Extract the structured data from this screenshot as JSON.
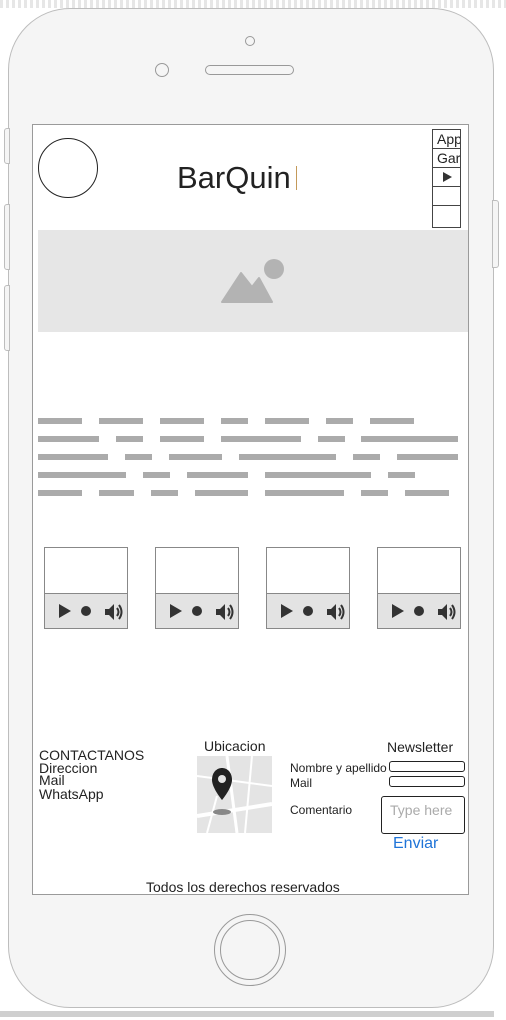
{
  "header": {
    "brand": "BarQuin",
    "menu": [
      "App",
      "Gar",
      "",
      "",
      ""
    ]
  },
  "icons": {
    "logo": "circle-logo-placeholder",
    "hero": "image-placeholder-icon",
    "menu_arrow": "play-triangle-icon",
    "audio_play": "play-icon",
    "audio_volume": "speaker-volume-icon",
    "map_pin": "map-pin-icon"
  },
  "audio_players": [
    {
      "label": "audio-1"
    },
    {
      "label": "audio-2"
    },
    {
      "label": "audio-3"
    },
    {
      "label": "audio-4"
    }
  ],
  "footer": {
    "contact": {
      "title": "CONTACTANOS",
      "items": [
        "Direccion",
        "Mail",
        "WhatsApp"
      ]
    },
    "location": {
      "title": "Ubicacion"
    },
    "newsletter": {
      "title": "Newsletter",
      "name_label": "Nombre y apellido",
      "mail_label": "Mail",
      "comment_label": "Comentario",
      "comment_placeholder": "Type here",
      "submit": "Enviar"
    },
    "copyright": "Todos los derechos reservados"
  },
  "colors": {
    "link": "#1f74d8",
    "placeholder_gray": "#ababab",
    "hero_bg": "#e6e6e6"
  }
}
